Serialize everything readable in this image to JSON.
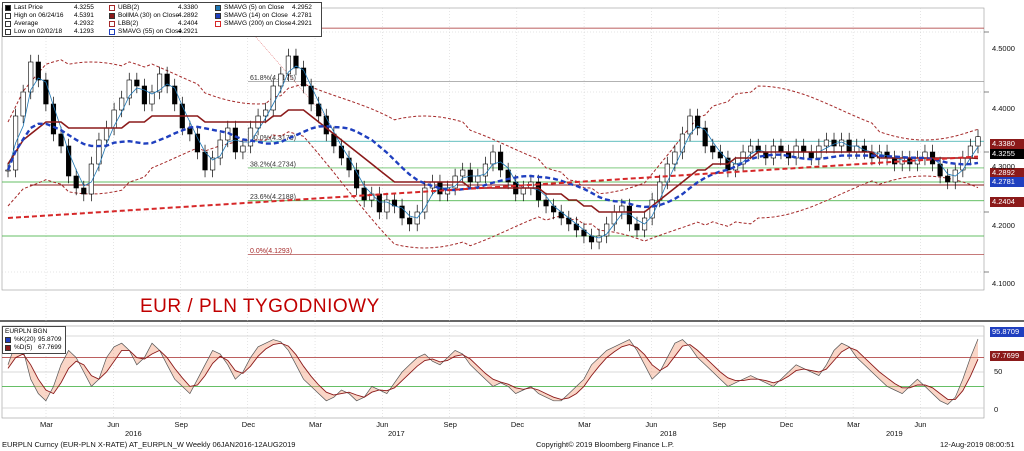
{
  "chart_data": {
    "type": "line",
    "title": "EUR / PLN TYGODNIOWY",
    "main_legend": [
      {
        "label": "Last Price",
        "value": "4.3255",
        "color": "#000000"
      },
      {
        "label": "High on 06/24/16",
        "value": "4.5391",
        "color": "#000000"
      },
      {
        "label": "Average",
        "value": "4.2932",
        "color": "#000000"
      },
      {
        "label": "Low on 02/02/18",
        "value": "4.1293",
        "color": "#000000"
      },
      {
        "label": "UBB(2)",
        "value": "4.3380",
        "color": "#a52a2a"
      },
      {
        "label": "BollMA (30) on Close",
        "value": "4.2892",
        "color": "#8b1a1a"
      },
      {
        "label": "LBB(2)",
        "value": "4.2404",
        "color": "#a52a2a"
      },
      {
        "label": "SMAVG (55) on Close",
        "value": "4.2921",
        "color": "#1f3fbf"
      },
      {
        "label": "SMAVG (5) on Close",
        "value": "4.2952",
        "color": "#1f77b4"
      },
      {
        "label": "SMAVG (14) on Close",
        "value": "4.2781",
        "color": "#1f3fbf"
      },
      {
        "label": "SMAVG (200) on Close",
        "value": "4.2921",
        "color": "#d62728"
      }
    ],
    "fib_levels": [
      {
        "label": "100.0%(4.5065)",
        "value": 4.5065
      },
      {
        "label": "61.8%(4.4175)",
        "value": 4.4175
      },
      {
        "label": "50.0%(4.3179)",
        "value": 4.3179
      },
      {
        "label": "38.2%(4.2734)",
        "value": 4.2734
      },
      {
        "label": "23.6%(4.2188)",
        "value": 4.2188
      },
      {
        "label": "0.0%(4.1293)",
        "value": 4.1293
      }
    ],
    "ylim": [
      4.07,
      4.54
    ],
    "y_ticks": [
      "4.5000",
      "4.4000",
      "4.3000",
      "4.2000",
      "4.1000"
    ],
    "right_tags": [
      {
        "label": "4.3380",
        "value": 4.338,
        "color": "#8b1a1a"
      },
      {
        "label": "4.3255",
        "value": 4.3255,
        "color": "#000000"
      },
      {
        "label": "4.2892",
        "value": 4.2892,
        "color": "#8b1a1a"
      },
      {
        "label": "4.2781",
        "value": 4.2781,
        "color": "#1f3fbf"
      },
      {
        "label": "4.2404",
        "value": 4.2404,
        "color": "#8b1a1a"
      }
    ],
    "x_months": [
      "Mar",
      "Jun",
      "Sep",
      "Dec",
      "Mar",
      "Jun",
      "Sep",
      "Dec",
      "Mar",
      "Jun",
      "Sep",
      "Dec",
      "Mar",
      "Jun"
    ],
    "x_years": [
      "2016",
      "2017",
      "2018",
      "2019"
    ],
    "close": [
      4.27,
      4.36,
      4.4,
      4.45,
      4.42,
      4.38,
      4.33,
      4.31,
      4.26,
      4.24,
      4.23,
      4.28,
      4.32,
      4.34,
      4.37,
      4.39,
      4.42,
      4.41,
      4.38,
      4.4,
      4.43,
      4.41,
      4.38,
      4.34,
      4.33,
      4.3,
      4.27,
      4.29,
      4.32,
      4.34,
      4.3,
      4.31,
      4.34,
      4.36,
      4.37,
      4.41,
      4.43,
      4.46,
      4.44,
      4.41,
      4.38,
      4.36,
      4.33,
      4.31,
      4.29,
      4.27,
      4.24,
      4.22,
      4.23,
      4.2,
      4.22,
      4.21,
      4.19,
      4.18,
      4.2,
      4.24,
      4.25,
      4.23,
      4.24,
      4.26,
      4.27,
      4.25,
      4.26,
      4.28,
      4.3,
      4.27,
      4.25,
      4.23,
      4.24,
      4.25,
      4.22,
      4.21,
      4.2,
      4.19,
      4.18,
      4.17,
      4.16,
      4.15,
      4.16,
      4.18,
      4.2,
      4.21,
      4.18,
      4.17,
      4.19,
      4.22,
      4.25,
      4.28,
      4.3,
      4.33,
      4.36,
      4.34,
      4.31,
      4.3,
      4.29,
      4.27,
      4.28,
      4.3,
      4.31,
      4.3,
      4.29,
      4.31,
      4.3,
      4.29,
      4.31,
      4.3,
      4.29,
      4.31,
      4.32,
      4.31,
      4.32,
      4.3,
      4.31,
      4.3,
      4.29,
      4.3,
      4.29,
      4.28,
      4.29,
      4.28,
      4.29,
      4.3,
      4.28,
      4.26,
      4.25,
      4.27,
      4.29,
      4.31,
      4.3255
    ],
    "bollma": [
      4.28,
      4.3,
      4.32,
      4.33,
      4.34,
      4.35,
      4.35,
      4.35,
      4.34,
      4.34,
      4.34,
      4.34,
      4.34,
      4.34,
      4.34,
      4.34,
      4.35,
      4.35,
      4.35,
      4.36,
      4.36,
      4.36,
      4.36,
      4.36,
      4.36,
      4.36,
      4.35,
      4.35,
      4.35,
      4.35,
      4.35,
      4.35,
      4.35,
      4.35,
      4.35,
      4.36,
      4.36,
      4.37,
      4.37,
      4.37,
      4.36,
      4.35,
      4.34,
      4.33,
      4.32,
      4.31,
      4.3,
      4.29,
      4.28,
      4.27,
      4.26,
      4.25,
      4.25,
      4.25,
      4.25,
      4.25,
      4.25,
      4.25,
      4.25,
      4.25,
      4.25,
      4.24,
      4.24,
      4.24,
      4.24,
      4.24,
      4.24,
      4.24,
      4.24,
      4.24,
      4.24,
      4.23,
      4.23,
      4.23,
      4.22,
      4.22,
      4.21,
      4.21,
      4.2,
      4.2,
      4.2,
      4.2,
      4.2,
      4.2,
      4.2,
      4.21,
      4.22,
      4.23,
      4.24,
      4.25,
      4.26,
      4.27,
      4.27,
      4.28,
      4.28,
      4.28,
      4.29,
      4.29,
      4.29,
      4.3,
      4.3,
      4.3,
      4.3,
      4.3,
      4.3,
      4.3,
      4.3,
      4.3,
      4.3,
      4.3,
      4.3,
      4.3,
      4.3,
      4.3,
      4.3,
      4.29,
      4.29,
      4.29,
      4.29,
      4.29,
      4.29,
      4.29,
      4.29,
      4.29,
      4.29,
      4.29,
      4.29,
      4.29,
      4.2892
    ],
    "osc_legend": [
      {
        "label": "EURPLN BGN",
        "value": ""
      },
      {
        "label": "%K(20)",
        "value": "95.8709",
        "color": "#1f3fbf"
      },
      {
        "label": "%D(5)",
        "value": "67.7699",
        "color": "#8b1a1a"
      }
    ],
    "osc_ylim": [
      0,
      100
    ],
    "osc_ticks": [
      "50",
      "0"
    ],
    "osc_tags": [
      {
        "label": "95.8709",
        "value": 95.8709,
        "color": "#1f3fbf"
      },
      {
        "label": "67.7699",
        "value": 67.7699,
        "color": "#8b1a1a"
      }
    ],
    "osc_k": [
      60,
      90,
      80,
      40,
      20,
      10,
      30,
      60,
      80,
      70,
      50,
      30,
      40,
      70,
      85,
      90,
      80,
      60,
      70,
      90,
      80,
      60,
      40,
      30,
      20,
      40,
      60,
      80,
      75,
      60,
      40,
      50,
      70,
      85,
      90,
      95,
      92,
      80,
      60,
      40,
      30,
      20,
      10,
      15,
      25,
      20,
      10,
      15,
      30,
      25,
      20,
      35,
      50,
      60,
      70,
      75,
      65,
      60,
      70,
      80,
      75,
      60,
      50,
      40,
      30,
      35,
      30,
      20,
      25,
      30,
      20,
      15,
      10,
      10,
      20,
      30,
      40,
      60,
      70,
      80,
      85,
      90,
      95,
      80,
      60,
      40,
      50,
      70,
      90,
      95,
      85,
      70,
      60,
      50,
      40,
      30,
      35,
      40,
      45,
      40,
      35,
      30,
      40,
      50,
      60,
      55,
      50,
      45,
      60,
      80,
      90,
      85,
      70,
      60,
      50,
      40,
      30,
      25,
      20,
      30,
      40,
      30,
      20,
      10,
      5,
      15,
      40,
      70,
      95.8709
    ],
    "osc_d": [
      55,
      70,
      75,
      60,
      40,
      25,
      20,
      35,
      55,
      65,
      60,
      45,
      40,
      50,
      65,
      80,
      80,
      70,
      68,
      75,
      80,
      70,
      55,
      42,
      30,
      32,
      45,
      62,
      72,
      66,
      52,
      48,
      58,
      72,
      82,
      88,
      90,
      86,
      74,
      58,
      44,
      32,
      22,
      18,
      20,
      22,
      18,
      15,
      22,
      25,
      24,
      28,
      38,
      48,
      58,
      66,
      68,
      64,
      66,
      72,
      74,
      68,
      58,
      48,
      40,
      36,
      33,
      28,
      26,
      28,
      25,
      20,
      15,
      12,
      14,
      20,
      30,
      45,
      58,
      70,
      78,
      85,
      88,
      84,
      74,
      60,
      52,
      58,
      72,
      86,
      88,
      80,
      70,
      60,
      50,
      42,
      38,
      38,
      40,
      40,
      38,
      35,
      38,
      44,
      52,
      54,
      52,
      50,
      54,
      66,
      78,
      84,
      80,
      70,
      60,
      50,
      42,
      34,
      28,
      28,
      32,
      32,
      28,
      20,
      12,
      12,
      24,
      44,
      67.7699
    ]
  },
  "footer": {
    "left": "EURPLN Curncy (EUR-PLN X-RATE) AT_EURPLN_W  Weekly 06JAN2016-12AUG2019",
    "center": "Copyright© 2019 Bloomberg Finance L.P.",
    "right": "12-Aug-2019 08:00:51"
  },
  "colors": {
    "up_candle": "#ffffff",
    "down_candle": "#000000",
    "bollinger": "#a52a2a",
    "bollma": "#8b1a1a",
    "sma55": "#1f3fbf",
    "sma5": "#1f77b4",
    "sma200": "#d62728",
    "fib_green": "#33aa33",
    "osc_fill": "#f4a582"
  }
}
